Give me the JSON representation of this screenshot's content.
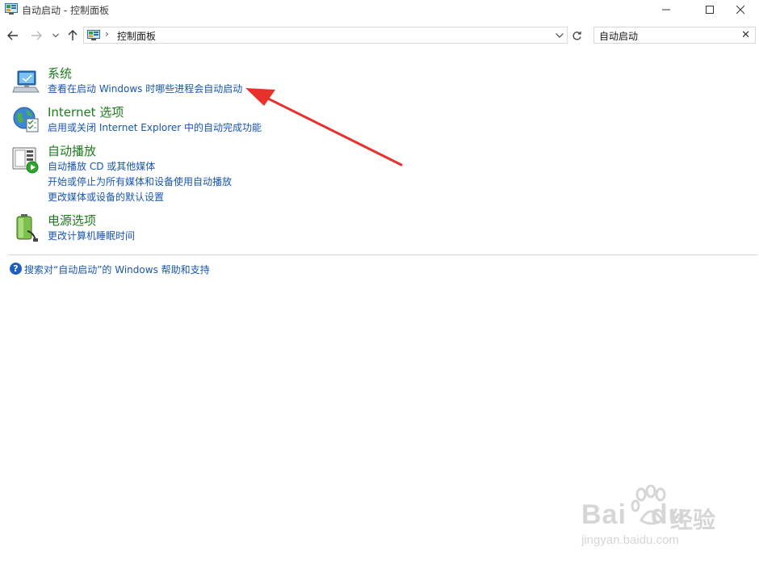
{
  "window": {
    "title": "自动启动 - 控制面板",
    "icon": "control-panel-icon"
  },
  "navigation": {
    "back_icon": "arrow-left-icon",
    "forward_icon": "arrow-right-icon",
    "recent_icon": "chevron-down-icon",
    "up_icon": "arrow-up-icon",
    "breadcrumb_separator": "›",
    "breadcrumb": "控制面板",
    "refresh_icon": "refresh-icon"
  },
  "search": {
    "value": "自动启动",
    "clear_label": "✕"
  },
  "results": [
    {
      "title": "系统",
      "icon": "system-computer-icon",
      "links": [
        "查看在启动 Windows 时哪些进程会自动启动"
      ]
    },
    {
      "title": "Internet 选项",
      "icon": "internet-options-globe-icon",
      "links": [
        "启用或关闭 Internet Explorer 中的自动完成功能"
      ]
    },
    {
      "title": "自动播放",
      "icon": "autoplay-icon",
      "links": [
        "自动播放 CD 或其他媒体",
        "开始或停止为所有媒体和设备使用自动播放",
        "更改媒体或设备的默认设置"
      ]
    },
    {
      "title": "电源选项",
      "icon": "power-options-battery-icon",
      "links": [
        "更改计算机睡眠时间"
      ]
    }
  ],
  "help": {
    "icon": "help-question-icon",
    "label": "搜索对“自动启动”的 Windows 帮助和支持"
  },
  "annotation": {
    "color": "#e8312b"
  },
  "watermark": {
    "logo": "Bai",
    "logo_tail": "du",
    "brand": "经验",
    "url": "jingyan.baidu.com"
  },
  "colors": {
    "title_green": "#1e7a1e",
    "link_blue": "#1a56b0"
  }
}
